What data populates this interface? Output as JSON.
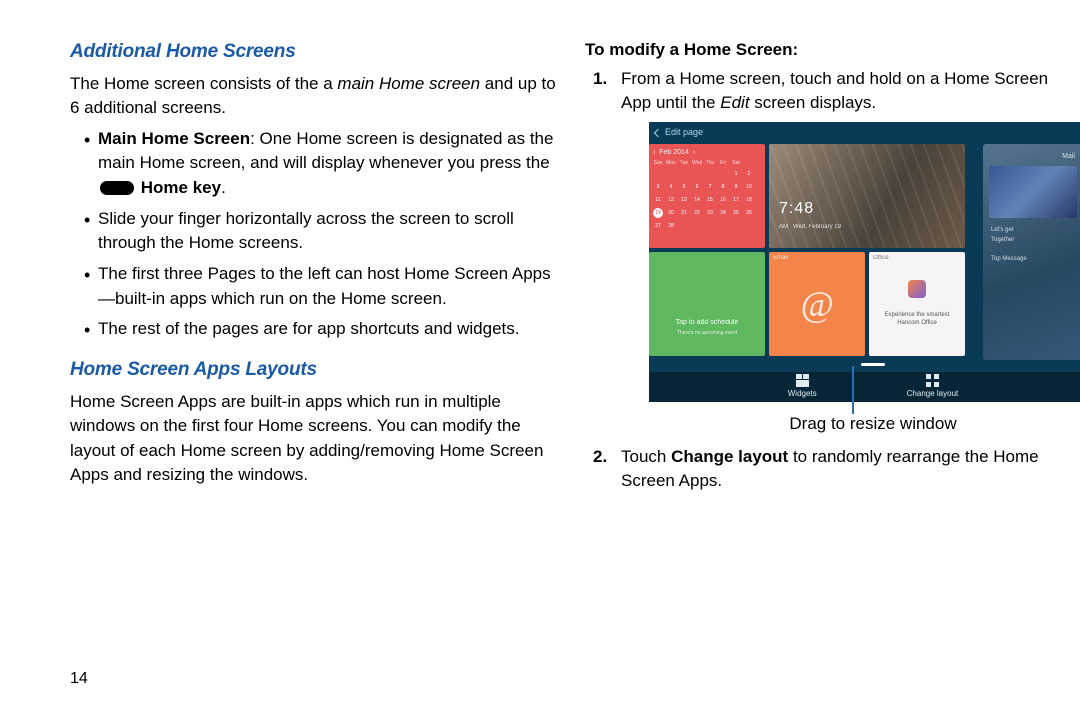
{
  "page_number": "14",
  "left": {
    "h1": "Additional Home Screens",
    "intro_a": "The Home screen consists of the a ",
    "intro_em": "main Home screen",
    "intro_b": " and up to 6 additional screens.",
    "b1_a": "Main Home Screen",
    "b1_b": ": One Home screen is designated as the main Home screen, and will display whenever you press the ",
    "b1_c": "Home key",
    "b1_d": ".",
    "b2": "Slide your finger horizontally across the screen to scroll through the Home screens.",
    "b3": "The first three Pages to the left can host Home Screen Apps—built-in apps which run on the Home screen.",
    "b4": "The rest of the pages are for app shortcuts and widgets.",
    "h2": "Home Screen Apps Layouts",
    "p2": "Home Screen Apps are built-in apps which run in multiple windows on the first four Home screens. You can modify the layout of each Home screen by adding/removing Home Screen Apps and resizing the windows."
  },
  "right": {
    "h1": "To modify a Home Screen:",
    "s1_a": "From a Home screen, touch and hold on a Home Screen App until the ",
    "s1_em": "Edit",
    "s1_b": " screen displays.",
    "caption": "Drag to resize window",
    "s2_a": "Touch ",
    "s2_b": "Change layout",
    "s2_c": " to randomly rearrange the Home Screen Apps."
  },
  "figure": {
    "editpage": "Edit page",
    "widgets": "Widgets",
    "changelayout": "Change layout",
    "email_label": "Email",
    "office_label": "Office",
    "office_text": "Experience the smartest Hancom Office",
    "sched": "Tap to add schedule",
    "month": "Feb 2014",
    "time": "7:48",
    "mail": "Mail"
  }
}
